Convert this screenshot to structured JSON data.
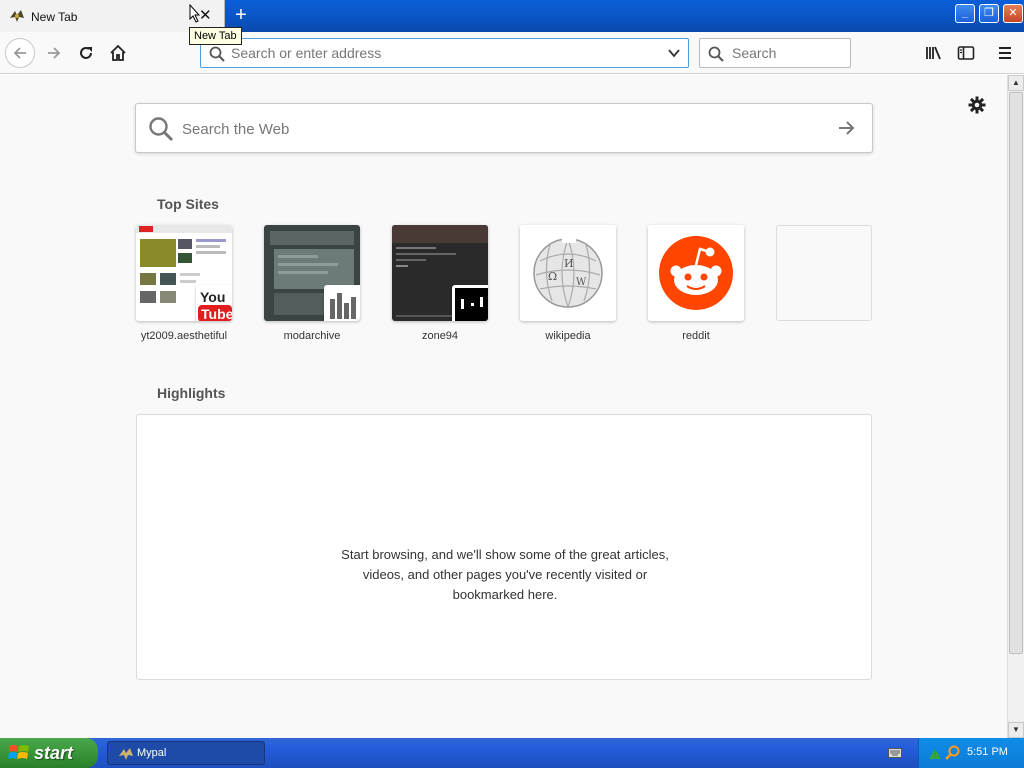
{
  "window": {
    "tab_title": "New Tab",
    "tooltip": "New Tab",
    "buttons": {
      "minimize": "_",
      "maximize": "❐",
      "close": "✕"
    }
  },
  "toolbar": {
    "address_placeholder": "Search or enter address",
    "search_placeholder": "Search"
  },
  "newtab": {
    "web_search_placeholder": "Search the Web",
    "top_sites_title": "Top Sites",
    "top_sites": [
      {
        "label": "yt2009.aesthetiful"
      },
      {
        "label": "modarchive"
      },
      {
        "label": "zone94"
      },
      {
        "label": "wikipedia"
      },
      {
        "label": "reddit"
      },
      {
        "label": ""
      }
    ],
    "highlights_title": "Highlights",
    "highlights_empty": "Start browsing, and we'll show some of the great articles, videos, and other pages you've recently visited or bookmarked here."
  },
  "taskbar": {
    "start_label": "start",
    "task_label": "Mypal",
    "clock": "5:51 PM"
  },
  "colors": {
    "accent": "#0a5fd8",
    "reddit": "#ff4500",
    "start_green": "#3c9a3c"
  }
}
